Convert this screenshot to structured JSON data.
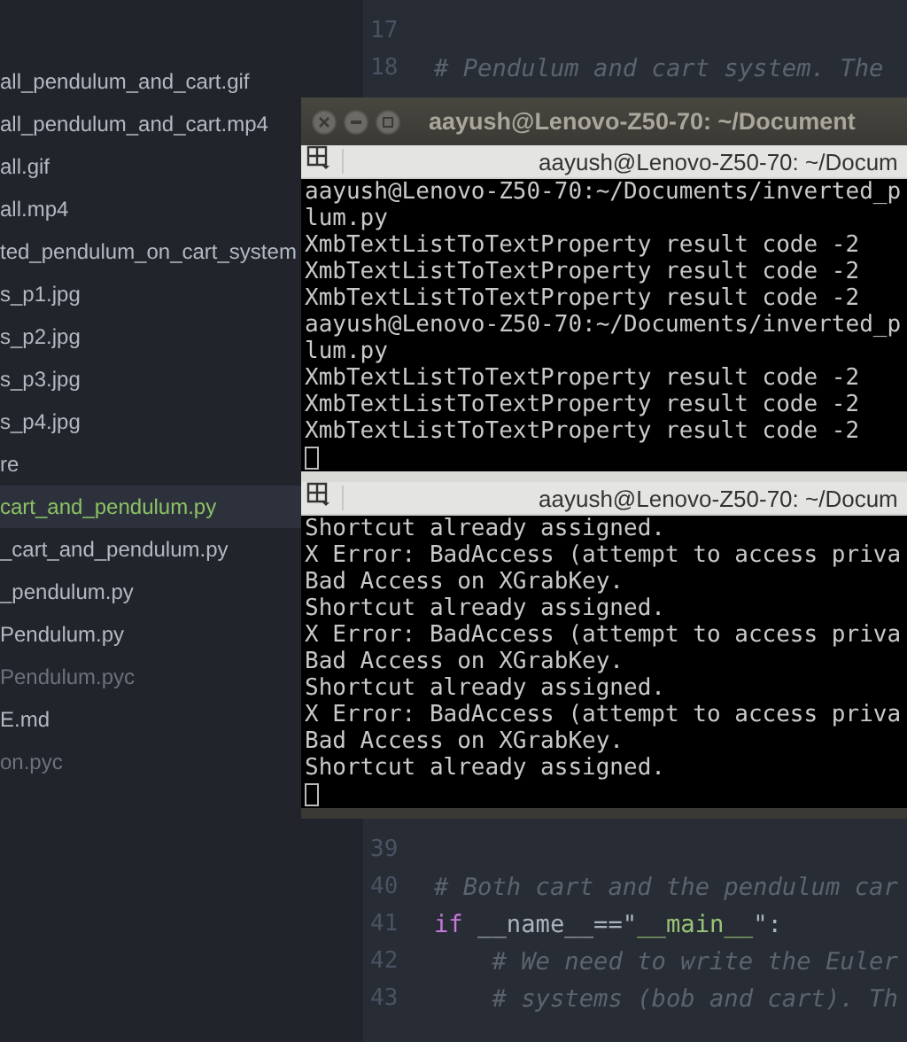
{
  "sidebar": {
    "items": [
      {
        "label": "all_pendulum_and_cart.gif",
        "selected": false,
        "dimmed": false
      },
      {
        "label": "all_pendulum_and_cart.mp4",
        "selected": false,
        "dimmed": false
      },
      {
        "label": "all.gif",
        "selected": false,
        "dimmed": false
      },
      {
        "label": "all.mp4",
        "selected": false,
        "dimmed": false
      },
      {
        "label": "ted_pendulum_on_cart_system",
        "selected": false,
        "dimmed": false
      },
      {
        "label": "s_p1.jpg",
        "selected": false,
        "dimmed": false
      },
      {
        "label": "s_p2.jpg",
        "selected": false,
        "dimmed": false
      },
      {
        "label": "s_p3.jpg",
        "selected": false,
        "dimmed": false
      },
      {
        "label": "s_p4.jpg",
        "selected": false,
        "dimmed": false
      },
      {
        "label": "re",
        "selected": false,
        "dimmed": false
      },
      {
        "label": "cart_and_pendulum.py",
        "selected": true,
        "dimmed": false
      },
      {
        "label": "_cart_and_pendulum.py",
        "selected": false,
        "dimmed": false
      },
      {
        "label": "_pendulum.py",
        "selected": false,
        "dimmed": false
      },
      {
        "label": "Pendulum.py",
        "selected": false,
        "dimmed": false
      },
      {
        "label": "Pendulum.pyc",
        "selected": false,
        "dimmed": true
      },
      {
        "label": "E.md",
        "selected": false,
        "dimmed": false
      },
      {
        "label": "on.pyc",
        "selected": false,
        "dimmed": true
      }
    ]
  },
  "editor": {
    "lines_top": [
      {
        "number": "17"
      },
      {
        "number": "18",
        "tokens": [
          {
            "text": "# Pendulum and cart system. The",
            "kind": "comment"
          }
        ]
      }
    ],
    "lines_bottom": [
      {
        "number": "39"
      },
      {
        "number": "40",
        "tokens": [
          {
            "text": "# Both cart and the pendulum car",
            "kind": "comment"
          }
        ]
      },
      {
        "number": "41",
        "tokens": [
          {
            "text": "if",
            "kind": "keyword"
          },
          {
            "text": " __name__==\"",
            "kind": "plain"
          },
          {
            "text": "__main__",
            "kind": "string"
          },
          {
            "text": "\":",
            "kind": "plain"
          }
        ]
      },
      {
        "number": "42",
        "tokens": [
          {
            "text": "    # We need to write the Euler",
            "kind": "comment"
          }
        ]
      },
      {
        "number": "43",
        "tokens": [
          {
            "text": "    # systems (bob and cart). Th",
            "kind": "comment"
          }
        ]
      }
    ]
  },
  "terminal_window": {
    "title": "aayush@Lenovo-Z50-70: ~/Document",
    "panes": [
      {
        "title": "aayush@Lenovo-Z50-70: ~/Docum",
        "lines": [
          "aayush@Lenovo-Z50-70:~/Documents/inverted_p",
          "lum.py",
          "XmbTextListToTextProperty result code -2",
          "XmbTextListToTextProperty result code -2",
          "XmbTextListToTextProperty result code -2",
          "aayush@Lenovo-Z50-70:~/Documents/inverted_p",
          "lum.py",
          "XmbTextListToTextProperty result code -2",
          "XmbTextListToTextProperty result code -2",
          "XmbTextListToTextProperty result code -2"
        ]
      },
      {
        "title": "aayush@Lenovo-Z50-70: ~/Docum",
        "lines": [
          "Shortcut already assigned.",
          "X Error: BadAccess (attempt to access priva",
          "Bad Access on XGrabKey.",
          "Shortcut already assigned.",
          "X Error: BadAccess (attempt to access priva",
          "Bad Access on XGrabKey.",
          "Shortcut already assigned.",
          "X Error: BadAccess (attempt to access priva",
          "Bad Access on XGrabKey.",
          "Shortcut already assigned."
        ]
      }
    ]
  }
}
